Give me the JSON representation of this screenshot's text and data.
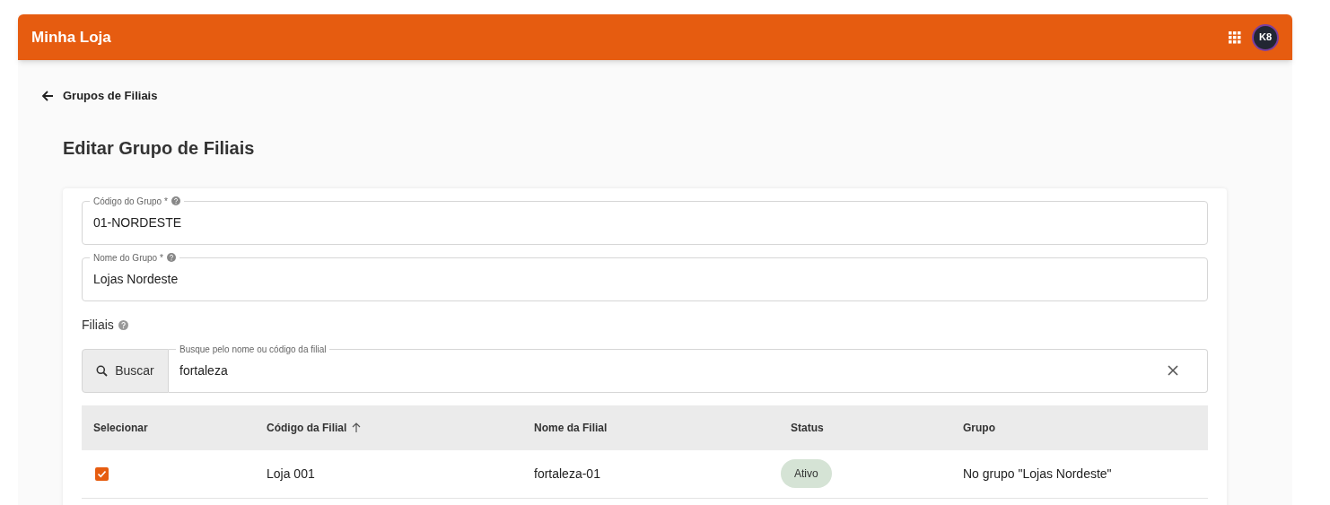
{
  "app_bar": {
    "title": "Minha Loja",
    "avatar_initials": "K8"
  },
  "breadcrumb": {
    "label": "Grupos de Filiais"
  },
  "page_title": "Editar Grupo de Filiais",
  "fields": [
    {
      "label": "Código do Grupo *",
      "value": "01-NORDESTE"
    },
    {
      "label": "Nome do Grupo *",
      "value": "Lojas Nordeste"
    }
  ],
  "branches": {
    "label": "Filiais",
    "search_button": "Buscar",
    "search_label": "Busque pelo nome ou código da filial",
    "search_value": "fortaleza"
  },
  "table": {
    "columns": [
      {
        "label": "Selecionar",
        "sorted": false
      },
      {
        "label": "Código da Filial",
        "sorted": true
      },
      {
        "label": "Nome da Filial",
        "sorted": false
      },
      {
        "label": "Status",
        "sorted": false
      },
      {
        "label": "Grupo",
        "sorted": false
      }
    ],
    "rows": [
      {
        "checked": true,
        "code": "Loja 001",
        "name": "fortaleza-01",
        "status": "Ativo",
        "group": "No grupo \"Lojas Nordeste\""
      }
    ]
  }
}
